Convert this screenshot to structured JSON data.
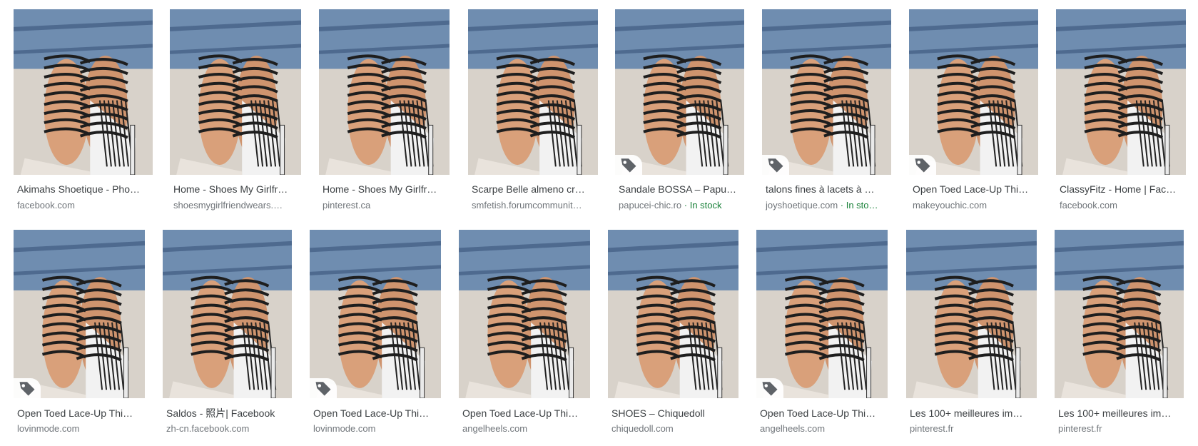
{
  "results": [
    {
      "title": "Akimahs Shoetique - Pho…",
      "source": "facebook.com",
      "stock": "",
      "tag": false
    },
    {
      "title": "Home - Shoes My Girlfr…",
      "source": "shoesmygirlfriendwears.…",
      "stock": "",
      "tag": false
    },
    {
      "title": "Home - Shoes My Girlfr…",
      "source": "pinterest.ca",
      "stock": "",
      "tag": false
    },
    {
      "title": "Scarpe Belle almeno cr…",
      "source": "smfetish.forumcommunit…",
      "stock": "",
      "tag": false
    },
    {
      "title": "Sandale BOSSA – Papu…",
      "source": "papucei-chic.ro",
      "stock": " · In stock",
      "tag": true
    },
    {
      "title": "talons fines à lacets à …",
      "source": "joyshoetique.com",
      "stock": " · In sto…",
      "tag": true
    },
    {
      "title": "Open Toed Lace-Up Thi…",
      "source": "makeyouchic.com",
      "stock": "",
      "tag": true
    },
    {
      "title": "ClassyFitz - Home | Fac…",
      "source": "facebook.com",
      "stock": "",
      "tag": false
    },
    {
      "title": "Open Toed Lace-Up Thi…",
      "source": "lovinmode.com",
      "stock": "",
      "tag": true
    },
    {
      "title": "Saldos - 照片| Facebook",
      "source": "zh-cn.facebook.com",
      "stock": "",
      "tag": false
    },
    {
      "title": "Open Toed Lace-Up Thi…",
      "source": "lovinmode.com",
      "stock": "",
      "tag": true
    },
    {
      "title": "Open Toed Lace-Up Thi…",
      "source": "angelheels.com",
      "stock": "",
      "tag": false
    },
    {
      "title": "SHOES – Chiquedoll",
      "source": "chiquedoll.com",
      "stock": "",
      "tag": false
    },
    {
      "title": "Open Toed Lace-Up Thi…",
      "source": "angelheels.com",
      "stock": "",
      "tag": true
    },
    {
      "title": "Les 100+ meilleures im…",
      "source": "pinterest.fr",
      "stock": "",
      "tag": false
    },
    {
      "title": "Les 100+ meilleures im…",
      "source": "pinterest.fr",
      "stock": "",
      "tag": false
    }
  ],
  "icons": {
    "tag": "shopping-tag-icon"
  },
  "colors": {
    "title": "#3c4043",
    "source": "#70757a",
    "stock": "#188038"
  }
}
